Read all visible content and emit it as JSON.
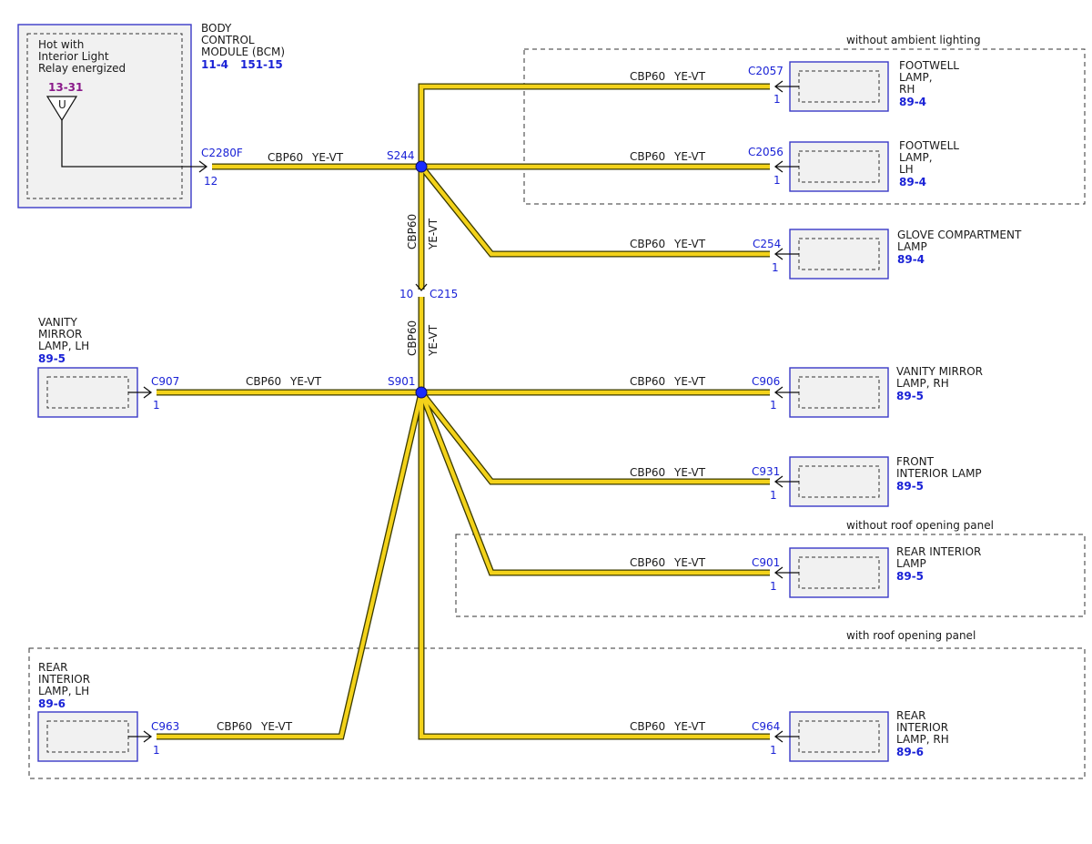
{
  "colors": {
    "wire": "#f3d21a",
    "connector_text": "#1a22d6",
    "ref_purple": "#8a1a8a",
    "splice": "#1a2cff"
  },
  "bcm": {
    "title_lines": [
      "BODY",
      "CONTROL",
      "MODULE (BCM)"
    ],
    "refs": [
      "11-4",
      "151-15"
    ],
    "inner_lines": [
      "Hot with",
      "Interior Light",
      "Relay energized"
    ],
    "power_ref": "13-31",
    "power_symbol": "U",
    "connector": "C2280F",
    "pin": "12"
  },
  "wire_label": {
    "circuit": "CBP60",
    "color": "YE-VT"
  },
  "splices": {
    "upper": "S244",
    "lower": "S901"
  },
  "inline_connector": {
    "pin": "10",
    "name": "C215"
  },
  "regions": {
    "ambient": "without ambient lighting",
    "roof_without": "without roof opening panel",
    "roof_with": "with roof opening panel"
  },
  "components": {
    "footwell_rh": {
      "lines": [
        "FOOTWELL",
        "LAMP,",
        "RH"
      ],
      "ref": "89-4",
      "connector": "C2057",
      "pin": "1"
    },
    "footwell_lh": {
      "lines": [
        "FOOTWELL",
        "LAMP,",
        "LH"
      ],
      "ref": "89-4",
      "connector": "C2056",
      "pin": "1"
    },
    "glove": {
      "lines": [
        "GLOVE COMPARTMENT",
        "LAMP"
      ],
      "ref": "89-4",
      "connector": "C254",
      "pin": "1"
    },
    "vanity_lh": {
      "lines": [
        "VANITY",
        "MIRROR",
        "LAMP, LH"
      ],
      "ref": "89-5",
      "connector": "C907",
      "pin": "1"
    },
    "vanity_rh": {
      "lines": [
        "VANITY MIRROR",
        "LAMP, RH"
      ],
      "ref": "89-5",
      "connector": "C906",
      "pin": "1"
    },
    "front_interior": {
      "lines": [
        "FRONT",
        "INTERIOR LAMP"
      ],
      "ref": "89-5",
      "connector": "C931",
      "pin": "1"
    },
    "rear_interior": {
      "lines": [
        "REAR INTERIOR",
        "LAMP"
      ],
      "ref": "89-5",
      "connector": "C901",
      "pin": "1"
    },
    "rear_interior_lh": {
      "lines": [
        "REAR",
        "INTERIOR",
        "LAMP, LH"
      ],
      "ref": "89-6",
      "connector": "C963",
      "pin": "1"
    },
    "rear_interior_rh": {
      "lines": [
        "REAR",
        "INTERIOR",
        "LAMP, RH"
      ],
      "ref": "89-6",
      "connector": "C964",
      "pin": "1"
    }
  }
}
